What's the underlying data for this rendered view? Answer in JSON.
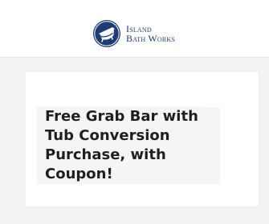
{
  "header": {
    "logo": {
      "line1": "Island",
      "line2": "Bath Works",
      "icon": "bathtub-badge-icon"
    }
  },
  "promo": {
    "headline": "Free Grab Bar with Tub Conversion Purchase, with Coupon!"
  },
  "colors": {
    "page_background": "#f3f3f3",
    "header_background": "#ffffff",
    "brand_navy": "#1e3c74",
    "headline_text": "#1f1f1f",
    "headline_background": "#f5f5f5"
  }
}
